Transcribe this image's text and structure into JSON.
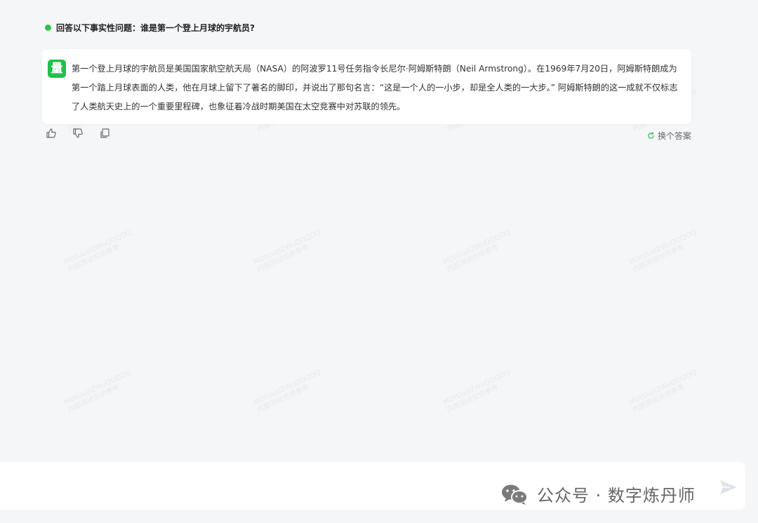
{
  "question": {
    "text": "回答以下事实性问题：谁是第一个登上月球的宇航员?"
  },
  "answer": {
    "avatar_label": "量",
    "text": "第一个登上月球的宇航员是美国国家航空航天局（NASA）的阿波罗11号任务指令长尼尔·阿姆斯特朗（Neil Armstrong）。在1969年7月20日，阿姆斯特朗成为第一个踏上月球表面的人类，他在月球上留下了著名的脚印，并说出了那句名言：“这是一个人的一小步，却是全人类的一大步。” 阿姆斯特朗的这一成就不仅标志了人类航天史上的一个重要里程碑，也象征着冷战时期美国在太空竞赛中对苏联的领先。"
  },
  "actions": {
    "icons": [
      "thumbs-up-icon",
      "thumbs-down-icon",
      "copy-icon"
    ],
    "regenerate_label": "换个答案"
  },
  "input": {
    "value": "",
    "placeholder": ""
  },
  "overlay": {
    "account_text": "公众号 · 数字炼丹师"
  },
  "watermark": {
    "line1": "MDtUuzIZWuQOQOQ",
    "line2": "内部测试仅供参考"
  },
  "colors": {
    "accent_green": "#1fc14a",
    "status_dot": "#2bc44a",
    "background": "#f5f6f8",
    "card": "#ffffff"
  }
}
